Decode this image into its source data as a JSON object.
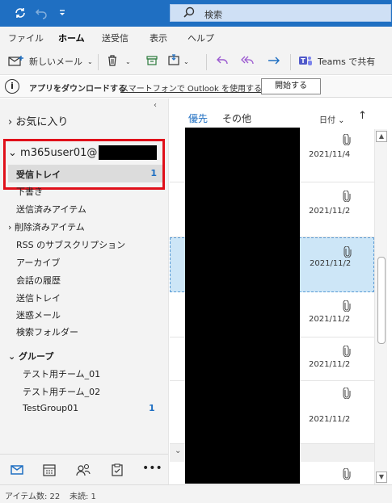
{
  "titlebar": {
    "search_label": "検索"
  },
  "ribbon_tabs": [
    "ファイル",
    "ホーム",
    "送受信",
    "表示",
    "ヘルプ"
  ],
  "toolbar": {
    "new_mail_label": "新しいメール",
    "teams_label": "Teams で共有"
  },
  "infobar": {
    "text": "アプリをダウンロードする",
    "link": "スマートフォンで Outlook を使用する",
    "button": "開始する"
  },
  "folders": {
    "favorites": "› お気に入り",
    "account": "⌄ m365user01@",
    "inbox_label": "受信トレイ",
    "inbox_count": "1",
    "items": [
      "下書き",
      "送信済みアイテム",
      "› 削除済みアイテム",
      "RSS のサブスクリプション",
      "アーカイブ",
      "会話の履歴",
      "送信トレイ",
      "迷惑メール",
      "検索フォルダー"
    ],
    "groups_header": "⌄ グループ",
    "groups": [
      "テスト用チーム_01",
      "テスト用チーム_02",
      "TestGroup01"
    ],
    "testgroup_count": "1"
  },
  "messages": {
    "tab_focused": "優先",
    "tab_other": "その他",
    "sort_label": "日付 ⌄",
    "sort_arrow": "↑",
    "dates": [
      "2021/11/4",
      "2021/11/2",
      "2021/11/2",
      "2021/11/2",
      "2021/11/2",
      "2021/11/2"
    ]
  },
  "statusbar": {
    "items": "アイテム数: 22",
    "unread": "未読: 1"
  },
  "colors": {
    "accent": "#1f6fc2",
    "highlight_box": "#e0101a",
    "selected_row": "#cde6f7"
  }
}
